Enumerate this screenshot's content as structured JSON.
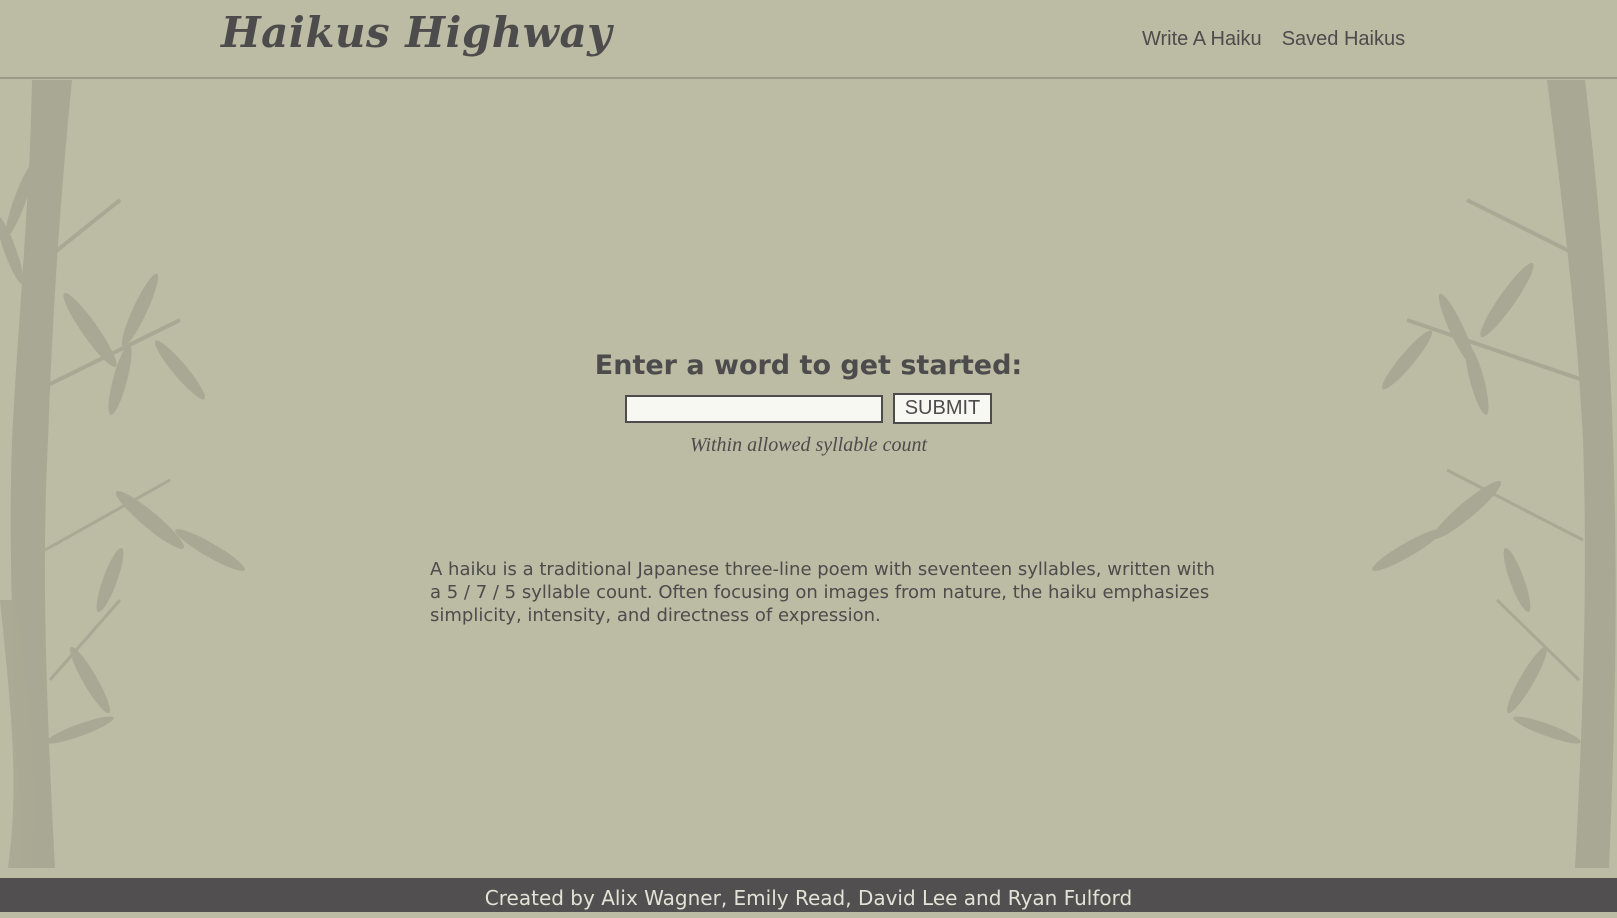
{
  "header": {
    "title": "Haikus Highway",
    "nav": [
      "Write A Haiku",
      "Saved Haikus"
    ]
  },
  "main": {
    "prompt": "Enter a word to get started:",
    "input_value": "",
    "submit_label": "SUBMIT",
    "status": "Within allowed syllable count"
  },
  "description": "A haiku is a traditional Japanese three-line poem with seventeen syllables, written with a 5 / 7 / 5  syllable count. Often focusing on images from nature, the haiku emphasizes simplicity, intensity, and directness of expression.",
  "footer": {
    "credits": "Created by Alix Wagner, Emily Read, David Lee and Ryan Fulford"
  },
  "colors": {
    "background": "#bcbba4",
    "text": "#4d4b4b",
    "footer_bg": "#514f4f",
    "bamboo": "#a9a894"
  },
  "decor": [
    "bamboo-left-illustration",
    "bamboo-right-illustration"
  ]
}
